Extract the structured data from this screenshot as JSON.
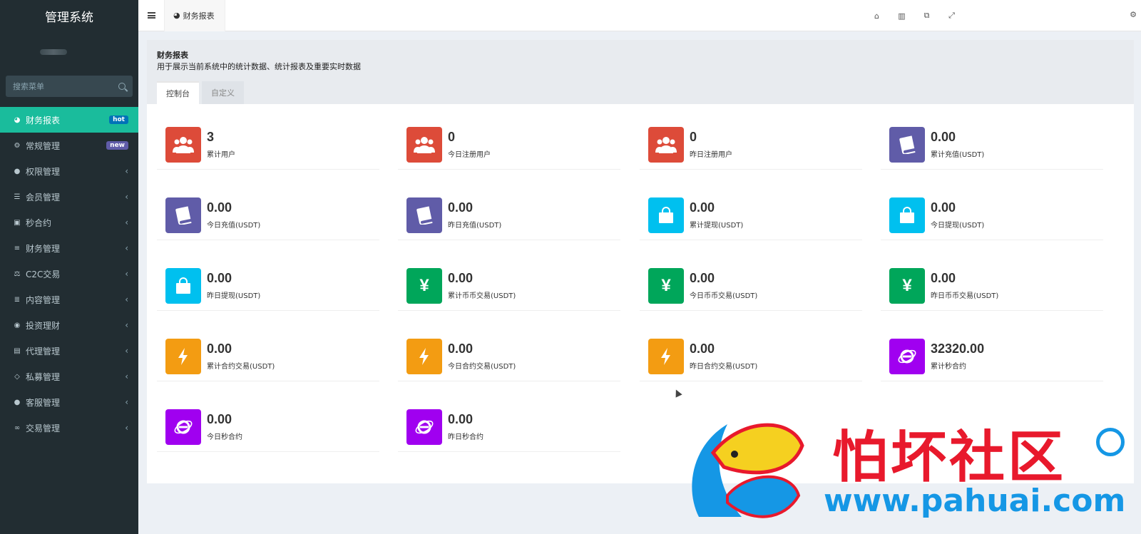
{
  "app": {
    "title": "管理系统"
  },
  "sidebar": {
    "search_placeholder": "搜索菜单",
    "items": [
      {
        "label": "财务报表",
        "icon": "dashboard-icon",
        "badge": "hot",
        "active": true
      },
      {
        "label": "常规管理",
        "icon": "cogs-icon",
        "badge": "new"
      },
      {
        "label": "权限管理",
        "icon": "users-icon"
      },
      {
        "label": "会员管理",
        "icon": "list-icon"
      },
      {
        "label": "秒合约",
        "icon": "calendar-icon"
      },
      {
        "label": "财务管理",
        "icon": "database-icon"
      },
      {
        "label": "C2C交易",
        "icon": "balance-scale-icon"
      },
      {
        "label": "内容管理",
        "icon": "align-left-icon"
      },
      {
        "label": "投资理财",
        "icon": "compass-icon"
      },
      {
        "label": "代理管理",
        "icon": "briefcase-icon"
      },
      {
        "label": "私募管理",
        "icon": "diamond-icon"
      },
      {
        "label": "客服管理",
        "icon": "comment-icon"
      },
      {
        "label": "交易管理",
        "icon": "handshake-icon"
      }
    ]
  },
  "topbar": {
    "tab_label": "财务报表",
    "icons": [
      "home-icon",
      "trash-icon",
      "translate-icon",
      "fullscreen-icon",
      "settings-gear-icon"
    ]
  },
  "header": {
    "title": "财务报表",
    "description": "用于展示当前系统中的统计数据、统计报表及重要实时数据",
    "tabs": [
      "控制台",
      "自定义"
    ]
  },
  "colors": {
    "sidebar_bg": "#222d32",
    "active": "#1abc9c",
    "red": "#dd4b39",
    "purple": "#605ca8",
    "aqua": "#00c0ef",
    "green": "#00a65a",
    "yellow": "#f39c12",
    "violet": "#a000f0"
  },
  "stats": [
    {
      "value": "3",
      "label": "累计用户",
      "icon": "users-icon",
      "color": "red"
    },
    {
      "value": "0",
      "label": "今日注册用户",
      "icon": "users-icon",
      "color": "red"
    },
    {
      "value": "0",
      "label": "昨日注册用户",
      "icon": "users-icon",
      "color": "red"
    },
    {
      "value": "0.00",
      "label": "累计充值(USDT)",
      "icon": "book-icon",
      "color": "purple"
    },
    {
      "value": "0.00",
      "label": "今日充值(USDT)",
      "icon": "book-icon",
      "color": "purple"
    },
    {
      "value": "0.00",
      "label": "昨日充值(USDT)",
      "icon": "book-icon",
      "color": "purple"
    },
    {
      "value": "0.00",
      "label": "累计提现(USDT)",
      "icon": "shopping-bag-icon",
      "color": "aqua"
    },
    {
      "value": "0.00",
      "label": "今日提现(USDT)",
      "icon": "shopping-bag-icon",
      "color": "aqua"
    },
    {
      "value": "0.00",
      "label": "昨日提现(USDT)",
      "icon": "shopping-bag-icon",
      "color": "aqua"
    },
    {
      "value": "0.00",
      "label": "累计币币交易(USDT)",
      "icon": "yen-icon",
      "color": "green"
    },
    {
      "value": "0.00",
      "label": "今日币币交易(USDT)",
      "icon": "yen-icon",
      "color": "green"
    },
    {
      "value": "0.00",
      "label": "昨日币币交易(USDT)",
      "icon": "yen-icon",
      "color": "green"
    },
    {
      "value": "0.00",
      "label": "累计合约交易(USDT)",
      "icon": "bolt-icon",
      "color": "yellow"
    },
    {
      "value": "0.00",
      "label": "今日合约交易(USDT)",
      "icon": "bolt-icon",
      "color": "yellow"
    },
    {
      "value": "0.00",
      "label": "昨日合约交易(USDT)",
      "icon": "bolt-icon",
      "color": "yellow"
    },
    {
      "value": "32320.00",
      "label": "累计秒合约",
      "icon": "internet-explorer-icon",
      "color": "violet"
    },
    {
      "value": "0.00",
      "label": "今日秒合约",
      "icon": "internet-explorer-icon",
      "color": "violet"
    },
    {
      "value": "0.00",
      "label": "昨日秒合约",
      "icon": "internet-explorer-icon",
      "color": "violet"
    }
  ],
  "watermark": {
    "text": "怕坏社区",
    "url": "www.pahuai.com"
  }
}
